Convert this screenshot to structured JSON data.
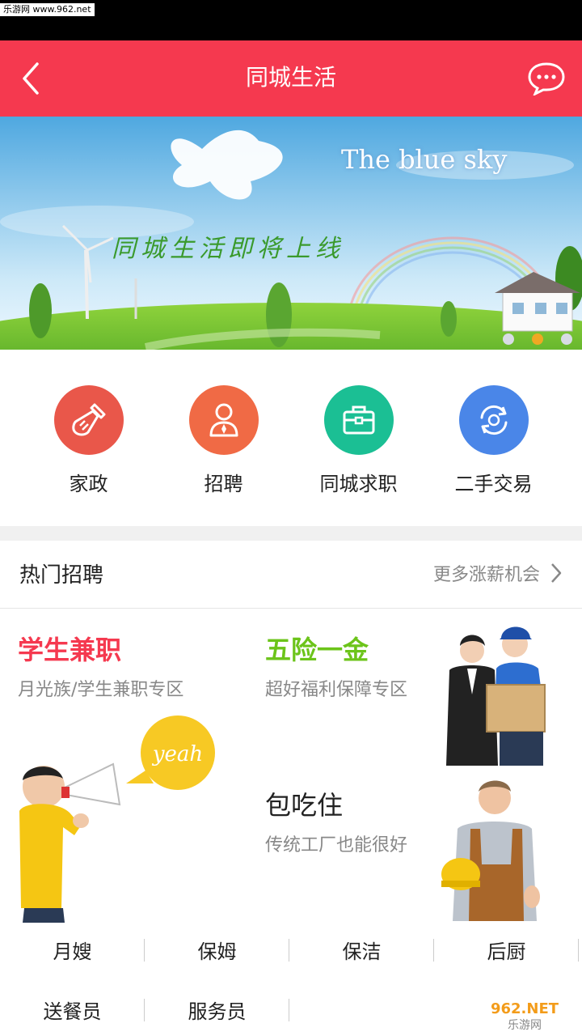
{
  "watermark_top": "乐游网 www.962.net",
  "nav": {
    "title": "同城生活",
    "back_icon": "chevron-left-icon",
    "message_icon": "chat-bubble-icon"
  },
  "banner": {
    "headline_en": "The blue sky",
    "tagline": "同城生活即将上线",
    "dots": 3,
    "active_dot": 2
  },
  "categories": [
    {
      "label": "家政",
      "icon": "broom-icon",
      "color": "#e9574a"
    },
    {
      "label": "招聘",
      "icon": "person-icon",
      "color": "#f06a45"
    },
    {
      "label": "同城求职",
      "icon": "briefcase-icon",
      "color": "#1bbf94"
    },
    {
      "label": "二手交易",
      "icon": "recycle-icon",
      "color": "#4a86e8"
    }
  ],
  "hot_jobs": {
    "title": "热门招聘",
    "more_label": "更多涨薪机会",
    "promos": [
      {
        "title": "学生兼职",
        "subtitle": "月光族/学生兼职专区",
        "color": "#f5394f"
      },
      {
        "title": "五险一金",
        "subtitle": "超好福利保障专区",
        "color": "#6cc41a"
      },
      {
        "title": "包吃住",
        "subtitle": "传统工厂也能很好",
        "color": "#222222"
      }
    ],
    "speech_bubble": "yeah"
  },
  "tags_row1": [
    "月嫂",
    "保姆",
    "保洁",
    "后厨"
  ],
  "tags_row2": [
    "送餐员",
    "服务员"
  ],
  "watermark_br": {
    "line1": "962.NET",
    "line2": "乐游网"
  }
}
